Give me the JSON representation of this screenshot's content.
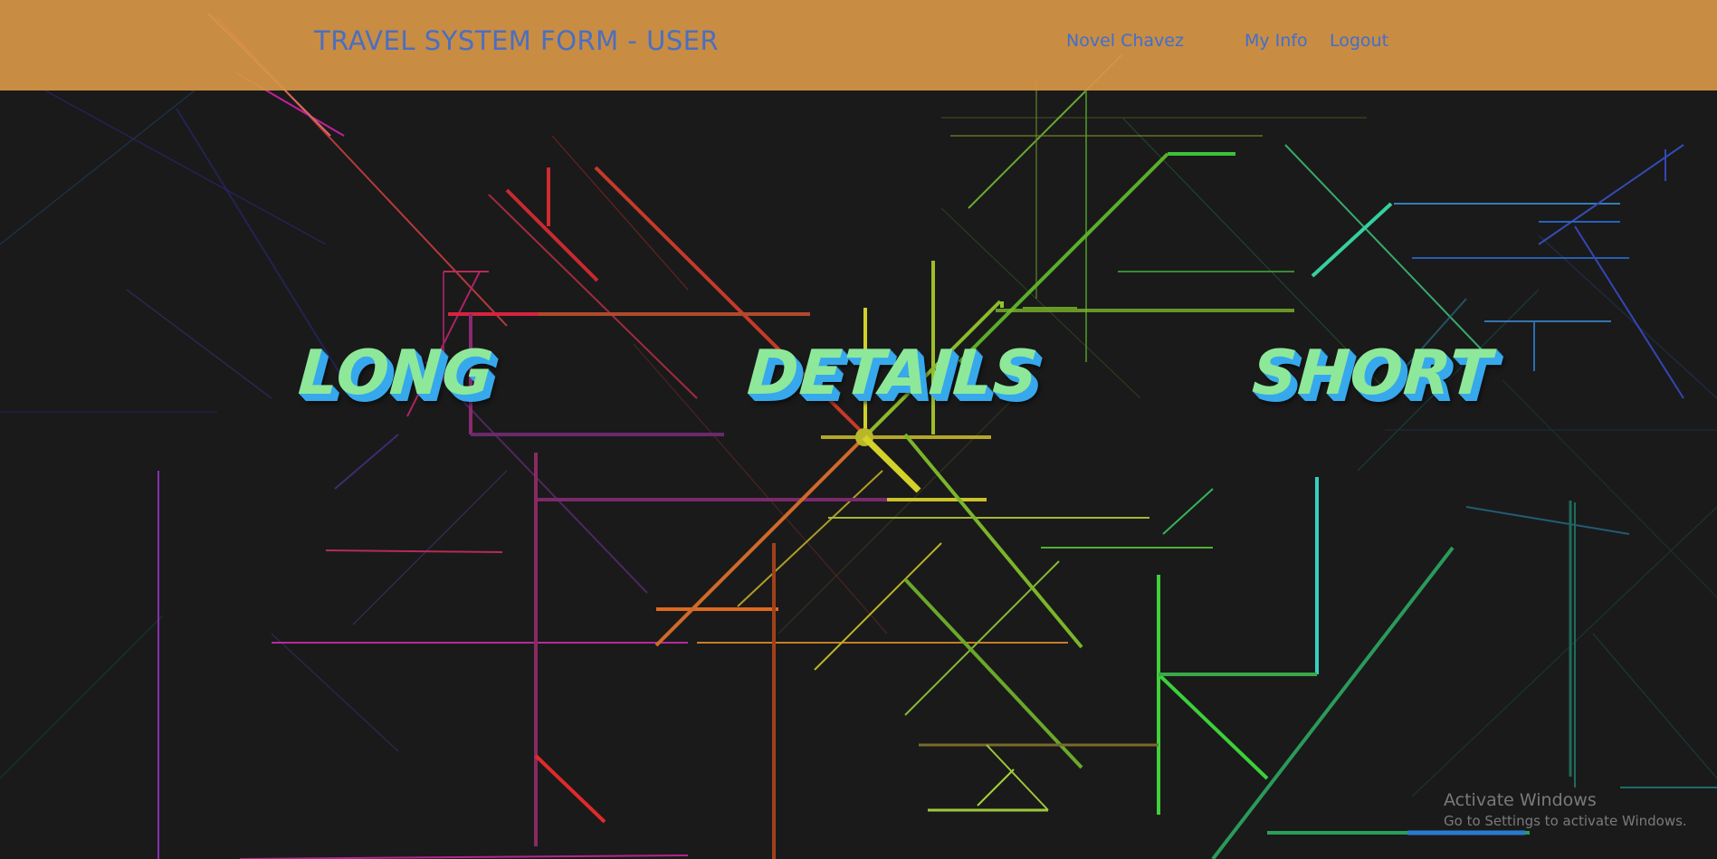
{
  "header": {
    "title": "TRAVEL SYSTEM FORM - USER",
    "user_name": "Novel Chavez",
    "my_info_label": "My Info",
    "logout_label": "Logout",
    "bar_color": "#d69646",
    "link_color": "#3f6fd0"
  },
  "main": {
    "options": [
      {
        "label": "LONG"
      },
      {
        "label": "DETAILS"
      },
      {
        "label": "SHORT"
      }
    ],
    "text_color": "#8ee89a",
    "shadow_color": "#37a8ec",
    "background_color": "#1a1a1a"
  },
  "watermark": {
    "title": "Activate Windows",
    "subtitle": "Go to Settings to activate Windows."
  }
}
